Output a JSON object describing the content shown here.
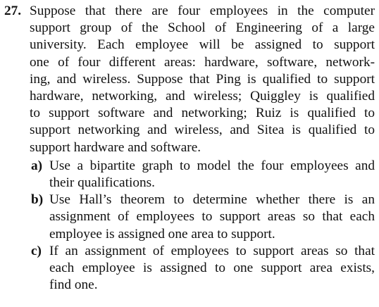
{
  "problem": {
    "number": "27.",
    "stem_lines": [
      "Suppose that there are four employees in the computer",
      "support group of the School of Engineering of a large",
      "university. Each employee will be assigned to support",
      "one of four different areas: hardware, software, network-",
      "ing, and wireless. Suppose that Ping is qualified to support",
      "hardware, networking, and wireless; Quiggley is qualified",
      "to support software and networking; Ruiz is qualified to",
      "support networking and wireless, and Sitea is qualified to",
      "support hardware and software."
    ],
    "parts": [
      {
        "label": "a)",
        "lines": [
          "Use a bipartite graph to model the four employees and",
          "their qualifications."
        ]
      },
      {
        "label": "b)",
        "lines": [
          "Use Hall’s theorem to determine whether there is an",
          "assignment of employees to support areas so that each",
          "employee is assigned one area to support."
        ]
      },
      {
        "label": "c)",
        "lines": [
          "If an assignment of employees to support areas so that",
          "each employee is assigned to one support area exists,",
          "find one."
        ]
      }
    ]
  }
}
